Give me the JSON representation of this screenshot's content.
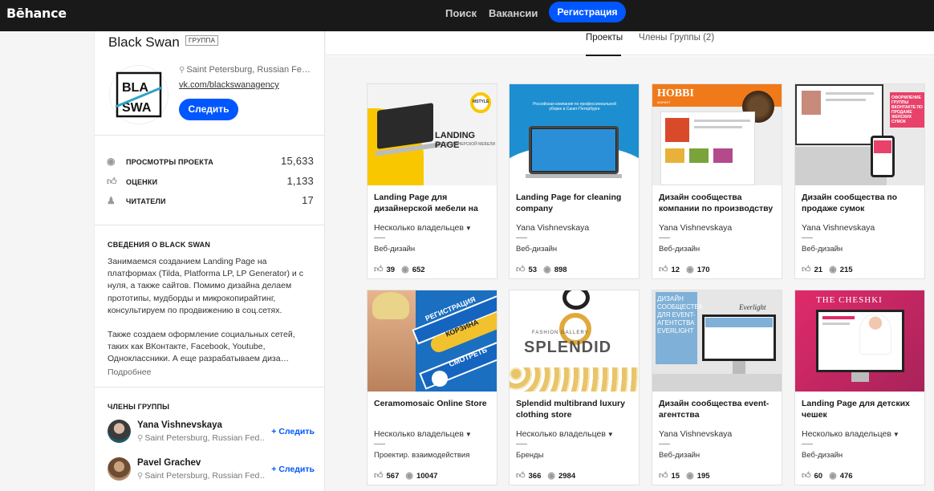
{
  "header": {
    "logo": "Bēhance",
    "nav_search": "Поиск",
    "nav_jobs": "Вакансии",
    "register": "Регистрация"
  },
  "group": {
    "name": "Black Swan",
    "badge": "ГРУППА",
    "location": "Saint Petersburg, Russian Feder…",
    "website": "vk.com/blackswanagency",
    "follow": "Следить"
  },
  "stats": [
    {
      "icon": "eye-icon",
      "label": "ПРОСМОТРЫ ПРОЕКТА",
      "value": "15,633"
    },
    {
      "icon": "thumbs-up-icon",
      "label": "ОЦЕНКИ",
      "value": "1,133"
    },
    {
      "icon": "user-follow-icon",
      "label": "ЧИТАТЕЛИ",
      "value": "17"
    }
  ],
  "about": {
    "title": "СВЕДЕНИЯ О BLACK SWAN",
    "text1": "Занимаемся созданием Landing Page на платформах (Tilda, Platforma LP, LP Generator) и с нуля, а также сайтов. Помимо дизайна делаем прототипы, мудборды и микрокопирайтинг, консультируем по продвижению в соц.сетях.",
    "text2": "Также создаем оформление социальных сетей, таких как ВКонтакте, Facebook, Youtube, Одноклассники. А еще разрабатываем диза…",
    "more": "Подробнее"
  },
  "members": {
    "title": "ЧЛЕНЫ ГРУППЫ",
    "items": [
      {
        "name": "Yana Vishnevskaya",
        "location": "Saint Petersburg, Russian Fed…",
        "follow": "+ Следить"
      },
      {
        "name": "Pavel Grachev",
        "location": "Saint Petersburg, Russian Fed…",
        "follow": "+ Следить"
      }
    ]
  },
  "tabs": {
    "projects": "Проекты",
    "members": "Члены Группы (2)"
  },
  "thumb_text": {
    "p1_headline": "LANDING PAGE",
    "p1_sub": "ДЛЯ ДИЗАЙНЕРСКОЙ МЕБЕЛИ",
    "p1_brand": "MSTYLE",
    "p2_headline": "Российская компания по профессиональной уборке в Санкт-Петербурге",
    "p3_brand": "HOBBI",
    "p3_sub": "MARKET",
    "p4_banner": "ОФОРМЛЕНИЕ ГРУППЫ ВКОНТАКТЕ ПО ПРОДАЖЕ ЖЕНСКИХ СУМОК",
    "p5_a": "РЕГИСТРАЦИЯ",
    "p5_b": "КОРЗИНА",
    "p5_c": "СМОТРЕТЬ",
    "p6_small": "FASHION GALLERY",
    "p6_brand": "SPLENDID",
    "p7_text": "ДИЗАЙН СООБЩЕСТВА ДЛЯ EVENT-АГЕНТСТВА EVERLIGHT",
    "p7_logo": "Everlight",
    "p8_brand": "THE CHESHKI"
  },
  "projects": [
    {
      "title": "Landing Page для дизайнерской мебели на",
      "owner": "Несколько владельцев",
      "has_menu": true,
      "field": "Веб-дизайн",
      "likes": "39",
      "views": "652"
    },
    {
      "title": "Landing Page for cleaning company",
      "owner": "Yana Vishnevskaya",
      "has_menu": false,
      "field": "Веб-дизайн",
      "likes": "53",
      "views": "898"
    },
    {
      "title": "Дизайн сообщества компании по производству",
      "owner": "Yana Vishnevskaya",
      "has_menu": false,
      "field": "Веб-дизайн",
      "likes": "12",
      "views": "170"
    },
    {
      "title": "Дизайн сообщества по продаже сумок",
      "owner": "Yana Vishnevskaya",
      "has_menu": false,
      "field": "Веб-дизайн",
      "likes": "21",
      "views": "215"
    },
    {
      "title": "Ceramomosaic Online Store",
      "owner": "Несколько владельцев",
      "has_menu": true,
      "field": "Проектир. взаимодействия",
      "likes": "567",
      "views": "10047"
    },
    {
      "title": "Splendid multibrand luxury clothing store",
      "owner": "Несколько владельцев",
      "has_menu": true,
      "field": "Бренды",
      "likes": "366",
      "views": "2984"
    },
    {
      "title": "Дизайн сообщества event-агентства",
      "owner": "Yana Vishnevskaya",
      "has_menu": false,
      "field": "Веб-дизайн",
      "likes": "15",
      "views": "195"
    },
    {
      "title": "Landing Page для детских чешек",
      "owner": "Несколько владельцев",
      "has_menu": true,
      "field": "Веб-дизайн",
      "likes": "60",
      "views": "476"
    }
  ],
  "colors": {
    "accent": "#0057ff",
    "header_bg": "#191919"
  }
}
